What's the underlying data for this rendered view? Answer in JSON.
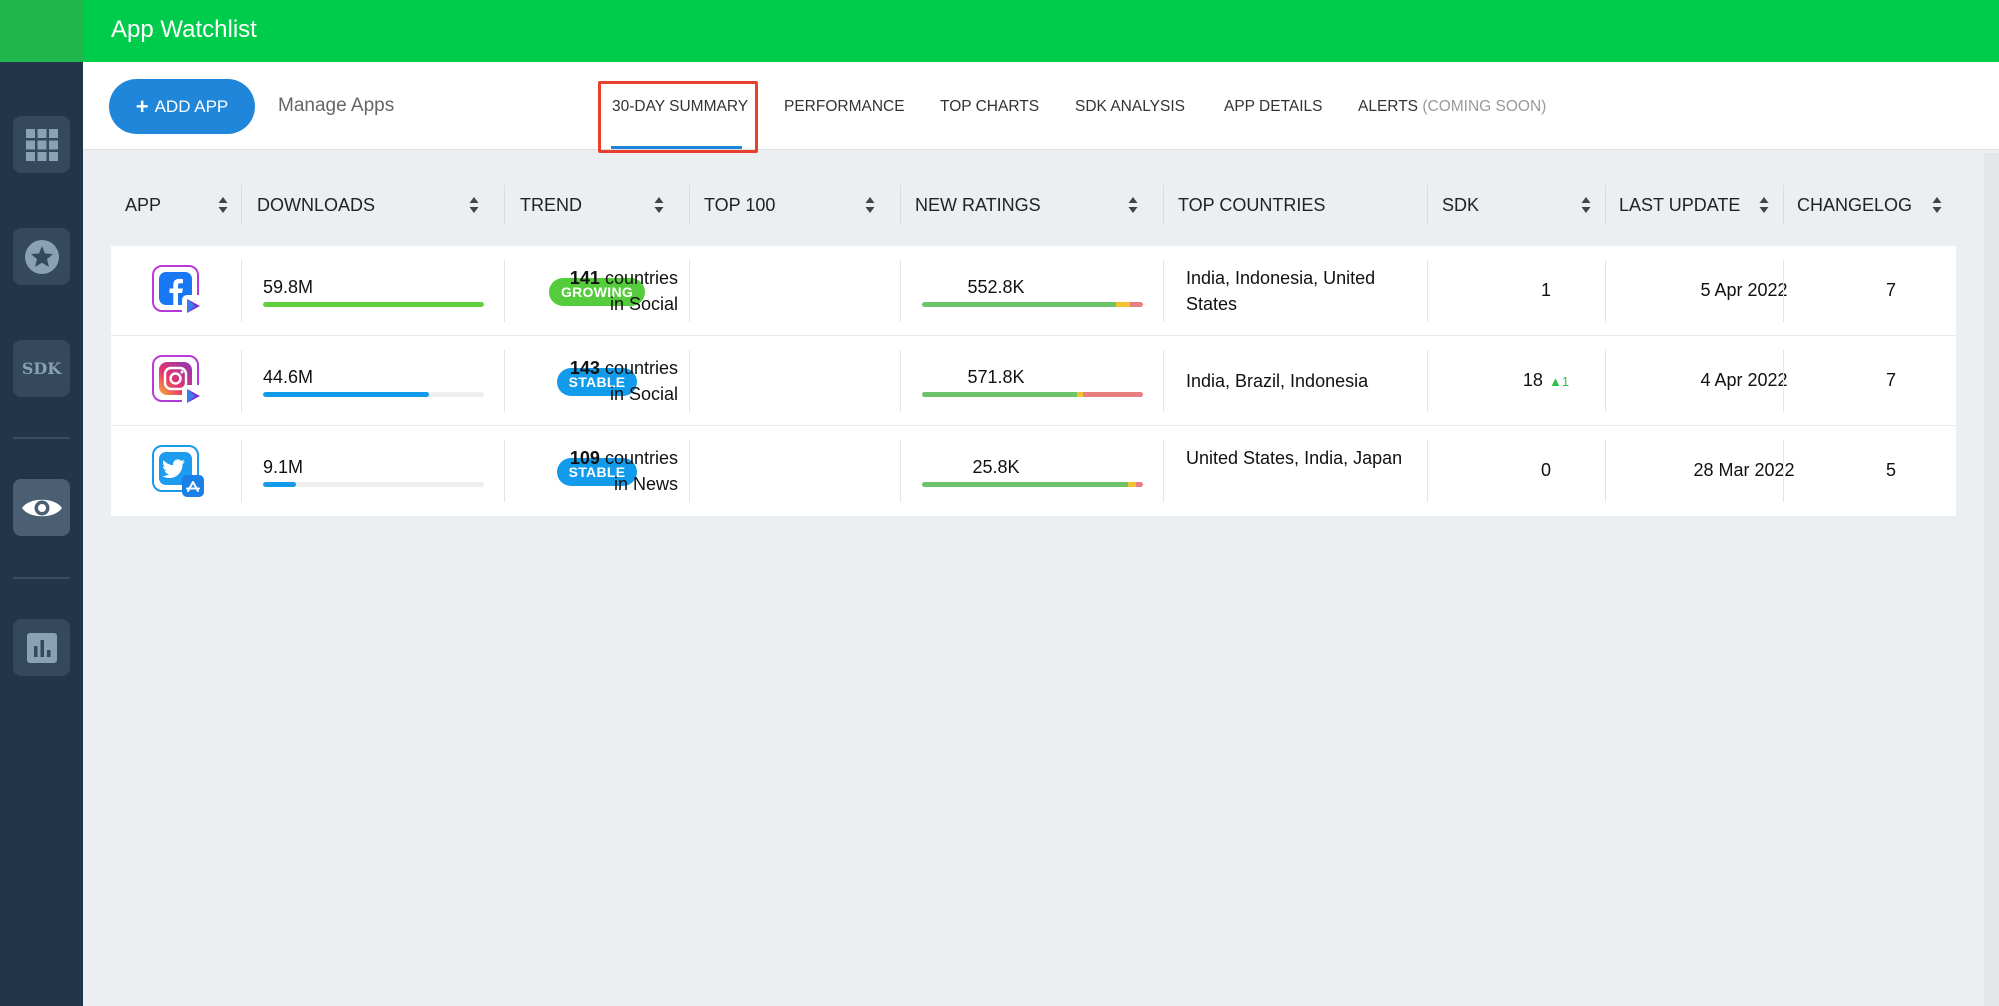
{
  "header": {
    "title": "App Watchlist"
  },
  "sidebar": {
    "items": [
      {
        "name": "apps-grid",
        "icon": "grid-icon"
      },
      {
        "name": "favorites",
        "icon": "star-icon"
      },
      {
        "name": "sdk",
        "icon": "sdk-icon",
        "label": "SDK"
      },
      {
        "name": "watchlist",
        "icon": "eye-icon",
        "active": true
      },
      {
        "name": "reports",
        "icon": "bar-chart-icon"
      }
    ]
  },
  "toolbar": {
    "add_app_label": "ADD APP",
    "manage_apps_label": "Manage Apps",
    "tabs": [
      {
        "label": "30-DAY SUMMARY",
        "active": true
      },
      {
        "label": "PERFORMANCE"
      },
      {
        "label": "TOP CHARTS"
      },
      {
        "label": "SDK ANALYSIS"
      },
      {
        "label": "APP DETAILS"
      },
      {
        "label": "ALERTS",
        "suffix": "(COMING SOON)"
      }
    ]
  },
  "table": {
    "columns": [
      "APP",
      "DOWNLOADS",
      "TREND",
      "TOP 100",
      "NEW RATINGS",
      "TOP COUNTRIES",
      "SDK",
      "LAST UPDATE",
      "CHANGELOG"
    ],
    "rows": [
      {
        "app_icon": "facebook-icon",
        "store_icon": "google-play-icon",
        "downloads": "59.8M",
        "downloads_fraction": 1.0,
        "downloads_color": "#5fcf3e",
        "trend": "GROWING",
        "top100_count": "141",
        "top100_text": "countries",
        "top100_category": "in Social",
        "new_ratings": "552.8K",
        "rating_segments": [
          0.88,
          0.06,
          0.06
        ],
        "top_countries": "India, Indonesia, United States",
        "sdk": "1",
        "sdk_delta": "",
        "last_update": "5 Apr 2022",
        "changelog": "7"
      },
      {
        "app_icon": "instagram-icon",
        "store_icon": "google-play-icon",
        "downloads": "44.6M",
        "downloads_fraction": 0.75,
        "downloads_color": "#129bea",
        "trend": "STABLE",
        "top100_count": "143",
        "top100_text": "countries",
        "top100_category": "in Social",
        "new_ratings": "571.8K",
        "rating_segments": [
          0.7,
          0.03,
          0.27
        ],
        "top_countries": "India, Brazil, Indonesia",
        "sdk": "18",
        "sdk_delta": "1",
        "last_update": "4 Apr 2022",
        "changelog": "7"
      },
      {
        "app_icon": "twitter-icon",
        "store_icon": "app-store-icon",
        "downloads": "9.1M",
        "downloads_fraction": 0.15,
        "downloads_color": "#129bea",
        "trend": "STABLE",
        "top100_count": "109",
        "top100_text": "countries",
        "top100_category": "in News",
        "new_ratings": "25.8K",
        "rating_segments": [
          0.93,
          0.04,
          0.03
        ],
        "top_countries": "United States, India, Japan",
        "sdk": "0",
        "sdk_delta": "",
        "last_update": "28 Mar 2022",
        "changelog": "5"
      }
    ]
  },
  "colors": {
    "header_green": "#00cc4c",
    "sidebar_bg": "#22364a",
    "primary_blue": "#1f86da",
    "growing_green": "#55cc3c",
    "stable_blue": "#129bea",
    "rating_positive": "#6cc36a",
    "rating_neutral": "#f2c230",
    "rating_negative": "#e57f80",
    "highlight_red": "#e8402c"
  }
}
